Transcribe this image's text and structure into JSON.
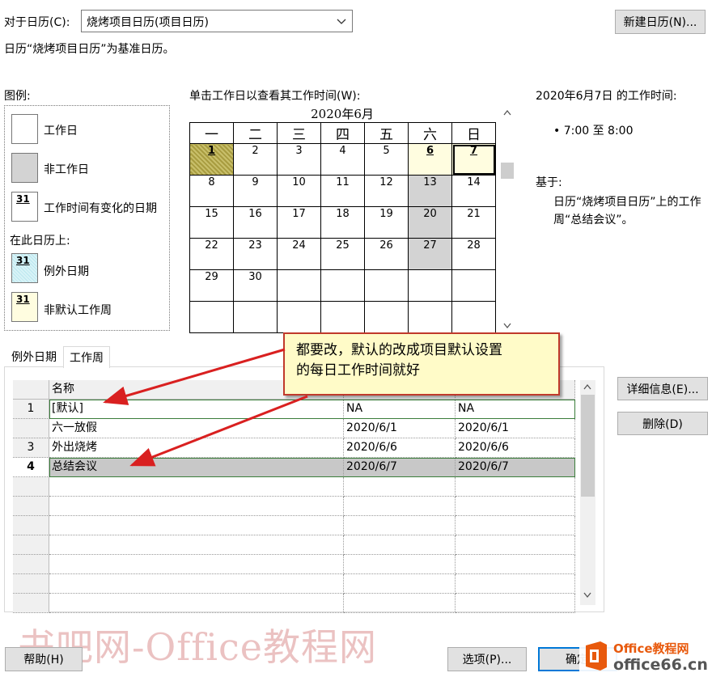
{
  "header": {
    "for_calendar_label": "对于日历(C):",
    "calendar_value": "烧烤项目日历(项目日历)",
    "new_calendar_button": "新建日历(N)...",
    "base_calendar_note": "日历“烧烤项目日历”为基准日历。"
  },
  "legend": {
    "title": "图例:",
    "items": [
      {
        "label": "工作日"
      },
      {
        "label": "非工作日"
      },
      {
        "label": "工作时间有变化的日期",
        "num": "31"
      }
    ],
    "on_this_calendar_label": "在此日历上:",
    "calendar_items": [
      {
        "label": "例外日期",
        "num": "31"
      },
      {
        "label": "非默认工作周",
        "num": "31"
      }
    ]
  },
  "calendar": {
    "instruction": "单击工作日以查看其工作时间(W):",
    "month_title": "2020年6月",
    "weekdays": [
      "一",
      "二",
      "三",
      "四",
      "五",
      "六",
      "日"
    ],
    "weeks": [
      [
        "1",
        "2",
        "3",
        "4",
        "5",
        "6",
        "7"
      ],
      [
        "8",
        "9",
        "10",
        "11",
        "12",
        "13",
        "14"
      ],
      [
        "15",
        "16",
        "17",
        "18",
        "19",
        "20",
        "21"
      ],
      [
        "22",
        "23",
        "24",
        "25",
        "26",
        "27",
        "28"
      ],
      [
        "29",
        "30",
        "",
        "",
        "",
        "",
        ""
      ],
      [
        "",
        "",
        "",
        "",
        "",
        "",
        ""
      ]
    ]
  },
  "working_time": {
    "title": "2020年6月7日 的工作时间:",
    "slot": "• 7:00 至 8:00",
    "based_on_label": "基于:",
    "based_on_text_1": "日历“烧烤项目日历”上的工作",
    "based_on_text_2": "周“总结会议”。"
  },
  "tabs": [
    {
      "label": "例外日期"
    },
    {
      "label": "工作周"
    }
  ],
  "grid": {
    "name_header": "名称",
    "rows": [
      {
        "id": "1",
        "name": "[默认]",
        "start": "NA",
        "end": "NA"
      },
      {
        "id": "",
        "name": "六一放假",
        "start": "2020/6/1",
        "end": "2020/6/1"
      },
      {
        "id": "3",
        "name": "外出烧烤",
        "start": "2020/6/6",
        "end": "2020/6/6"
      },
      {
        "id": "4",
        "name": "总结会议",
        "start": "2020/6/7",
        "end": "2020/6/7"
      }
    ]
  },
  "side_buttons": {
    "details": "详细信息(E)...",
    "delete": "删除(D)"
  },
  "callout": {
    "line1": "都要改，默认的改成项目默认设置",
    "line2": "的每日工作时间就好"
  },
  "footer": {
    "help": "帮助(H)",
    "options": "选项(P)...",
    "ok_partial": "确定",
    "watermark": "书吧网-Office教程网",
    "logo_line1": "Office教程网",
    "logo_line2": "office66.cn"
  },
  "colors": {
    "callout_border": "#c0392b",
    "callout_bg": "#fffbc8",
    "arrow": "#d92020",
    "selected_row": "#c8c8c8",
    "nonwork_gray": "#d3d3d3",
    "logo_orange": "#e8590c"
  }
}
